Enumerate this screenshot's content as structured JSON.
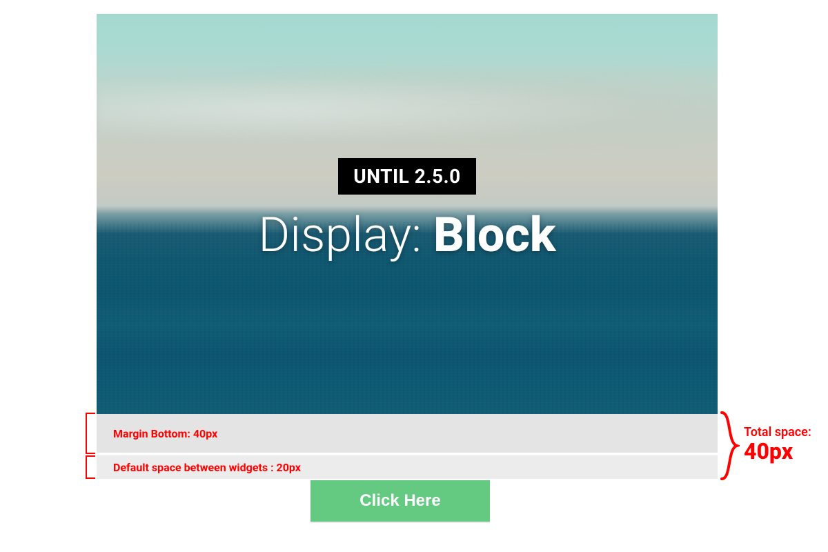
{
  "hero": {
    "badge": "UNTIL 2.5.0",
    "headline_light": "Display: ",
    "headline_bold": "Block"
  },
  "margins": {
    "row1": "Margin Bottom: 40px",
    "row2": "Default space between widgets : 20px"
  },
  "total": {
    "label": "Total space:",
    "value": "40px"
  },
  "cta": {
    "label": "Click Here"
  },
  "colors": {
    "annotation": "#ff0000",
    "cta_bg": "#65ca81"
  }
}
